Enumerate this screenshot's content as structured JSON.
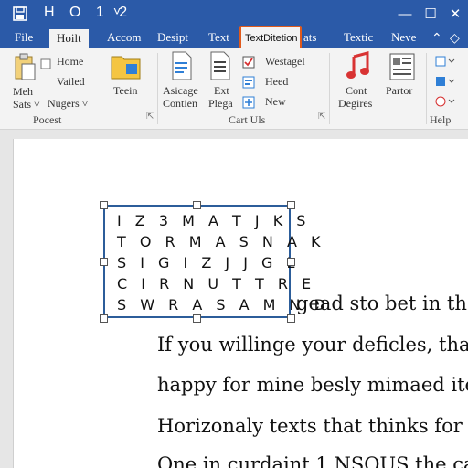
{
  "window": {
    "title": "H O 1 2",
    "chevron": "˅",
    "minimize": "—",
    "maximize": "☐",
    "close": "✕"
  },
  "tabs": [
    {
      "label": "File"
    },
    {
      "label": "Hoilt"
    },
    {
      "label": "Accom"
    },
    {
      "label": "Desipt"
    },
    {
      "label": "Text"
    },
    {
      "label": "TextDitetion"
    },
    {
      "label": "ats"
    },
    {
      "label": "Textic"
    },
    {
      "label": "Neve"
    }
  ],
  "ribbon": {
    "clipboard": {
      "home": "Home",
      "vailed": "Vailed",
      "meh": "Meh",
      "sats": "Sats ˅",
      "nugers": "Nugers ˅",
      "group": "Pocest"
    },
    "teein": "Teein",
    "asicage": "Asicage",
    "contien": "Contien",
    "ext": "Ext",
    "plega": "Plega",
    "westagel": "Westagel",
    "heed": "Heed",
    "new": "New",
    "cartuls": "Cart Uls",
    "cont": "Cont",
    "degires": "Degires",
    "partor": "Partor",
    "help": "Help"
  },
  "textbox": {
    "rows": [
      "I Z 3 M A T  J K S",
      "T O R M A S  N A K",
      "S I G I Z J  J G L",
      "C I R N U T  T R E",
      "S W R A S A  M N D"
    ]
  },
  "body_lines": [
    "gead sto bet in th",
    "If you willinge your deficles, that",
    "happy for mine besly mimaed ite",
    "Horizonaly texts that thinks for s",
    "One in curdaint 1 NSQUS the ca"
  ],
  "colors": {
    "title_bar": "#2b5aa8",
    "ribbon": "#f3f3f3",
    "callout": "#e05a1c",
    "textbox_border": "#2c5d9a"
  }
}
